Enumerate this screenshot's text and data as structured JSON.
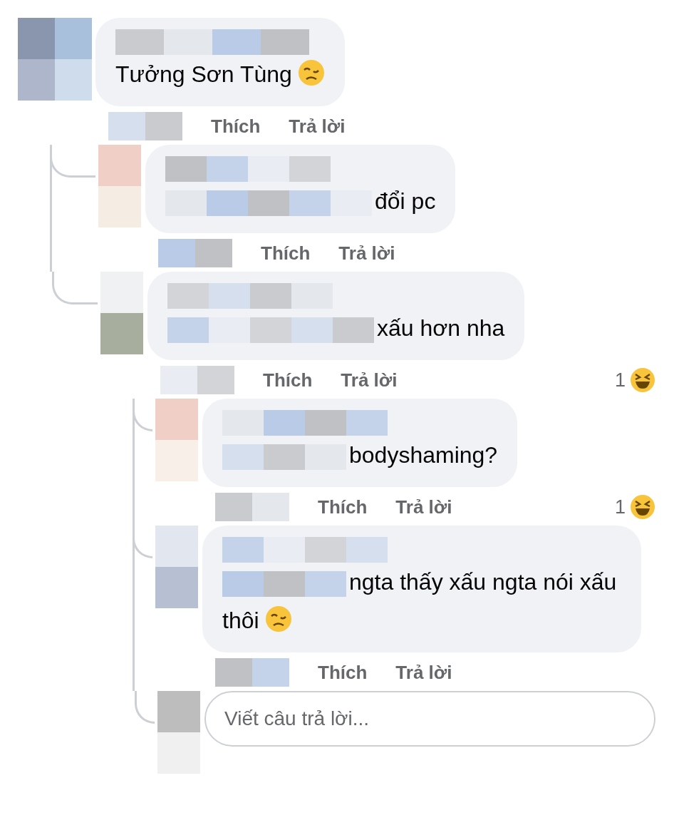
{
  "comments": [
    {
      "text": "Tưởng Sơn Tùng",
      "emoji": true,
      "actions": [
        "Thích",
        "Trả lời"
      ],
      "replies": [
        {
          "text": "đổi pc",
          "emoji": false,
          "actions": [
            "Thích",
            "Trả lời"
          ]
        },
        {
          "text": "xấu hơn nha",
          "emoji": false,
          "actions": [
            "Thích",
            "Trả lời"
          ],
          "reaction": {
            "count": "1"
          },
          "replies": [
            {
              "text": "bodyshaming?",
              "emoji": false,
              "actions": [
                "Thích",
                "Trả lời"
              ],
              "reaction": {
                "count": "1"
              }
            },
            {
              "text": "ngta thấy xấu ngta nói xấu thôi",
              "emoji": true,
              "actions": [
                "Thích",
                "Trả lời"
              ]
            }
          ],
          "composer": {
            "placeholder": "Viết câu trả lời..."
          }
        }
      ]
    }
  ]
}
